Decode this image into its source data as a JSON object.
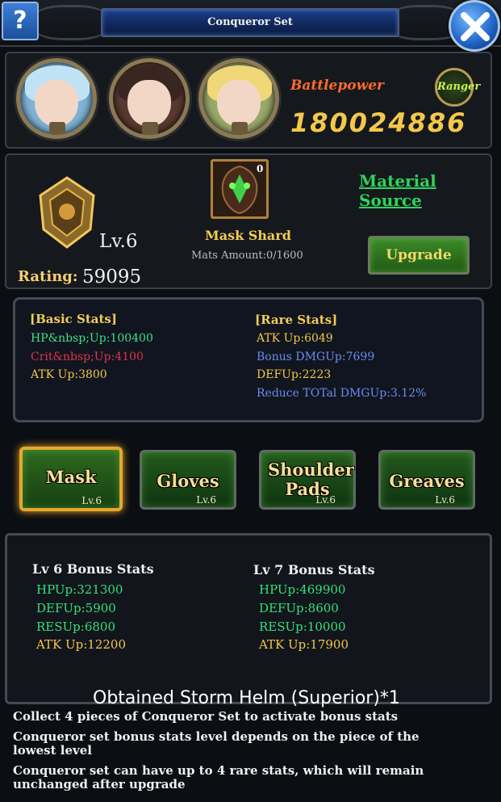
{
  "window": {
    "title": "Conqueror Set",
    "help_label": "?"
  },
  "heroes": [
    {
      "name": "hero-1",
      "hair_color": "#bfe3f5"
    },
    {
      "name": "hero-2",
      "hair_color": "#3a2620"
    },
    {
      "name": "hero-3",
      "hair_color": "#f0d878"
    }
  ],
  "battlepower": {
    "label": "Battlepower",
    "value": "180024886"
  },
  "class_badge": "Ranger",
  "set": {
    "level": "Lv.6",
    "rating_label": "Rating:",
    "rating_value": "59095"
  },
  "material": {
    "count": "0",
    "name": "Mask Shard",
    "amount": "Mats Amount:0/1600",
    "source_link": "Material Source"
  },
  "upgrade_button": "Upgrade",
  "stats": {
    "basic_title": "[Basic Stats]",
    "basic": [
      {
        "text": "HP&nbsp;Up:100400",
        "color": "#3fe08a"
      },
      {
        "text": "Crit&nbsp;Up:4100",
        "color": "#e0334a"
      },
      {
        "text": "ATK Up:3800",
        "color": "#f3c84a"
      }
    ],
    "rare_title": "[Rare Stats]",
    "rare": [
      {
        "text": "ATK Up:6049",
        "color": "#f3c84a"
      },
      {
        "text": "Bonus DMGUp:7699",
        "color": "#6b8cf0"
      },
      {
        "text": "DEFUp:2223",
        "color": "#f3c84a"
      },
      {
        "text": "Reduce TOTal DMGUp:3.12%",
        "color": "#6b8cf0"
      }
    ]
  },
  "pieces": [
    {
      "name": "Mask",
      "level": "Lv.6",
      "active": true
    },
    {
      "name": "Gloves",
      "level": "Lv.6",
      "active": false
    },
    {
      "name": "Shoulder Pads",
      "level": "Lv.6",
      "active": false
    },
    {
      "name": "Greaves",
      "level": "Lv.6",
      "active": false
    }
  ],
  "bonus": {
    "current_title": "Lv 6 Bonus Stats",
    "current": [
      "HPUp:321300",
      "DEFUp:5900",
      "RESUp:6800",
      "ATK Up:12200"
    ],
    "next_title": "Lv 7 Bonus Stats",
    "next": [
      "HPUp:469900",
      "DEFUp:8600",
      "RESUp:10000",
      "ATK Up:17900"
    ]
  },
  "toast": "Obtained Storm Helm (Superior)*1",
  "notes": [
    "Collect 4 pieces of Conqueror Set to activate bonus stats",
    "Conqueror set bonus stats level depends on the piece of the lowest level",
    "Conqueror set can have up to 4 rare stats, which will remain unchanged after upgrade"
  ]
}
